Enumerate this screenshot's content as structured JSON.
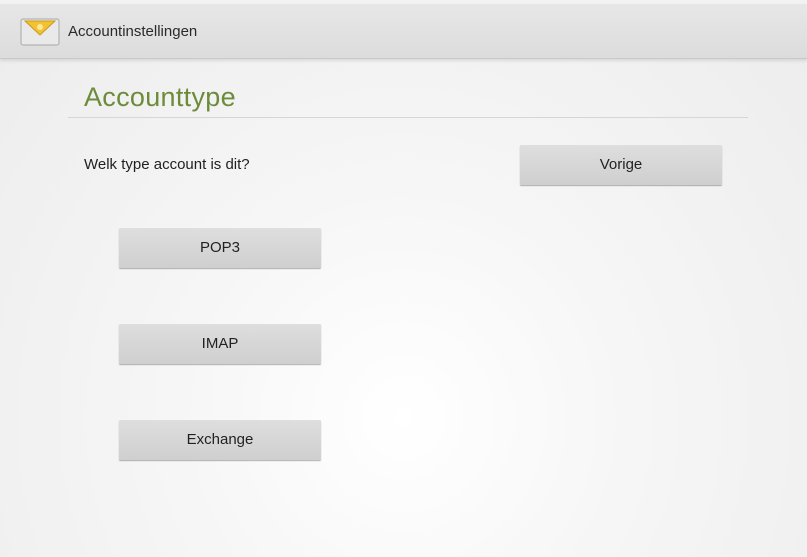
{
  "action_bar": {
    "title": "Accountinstellingen",
    "icon": "mail-envelope-icon"
  },
  "section": {
    "title": "Accounttype"
  },
  "question": "Welk type account is dit?",
  "buttons": {
    "back": "Vorige",
    "pop3": "POP3",
    "imap": "IMAP",
    "exchange": "Exchange"
  },
  "colors": {
    "section_title": "#6d8c3a",
    "action_bar": "#e3e3e3",
    "button": "#d6d6d6",
    "icon": "#f2c232"
  }
}
